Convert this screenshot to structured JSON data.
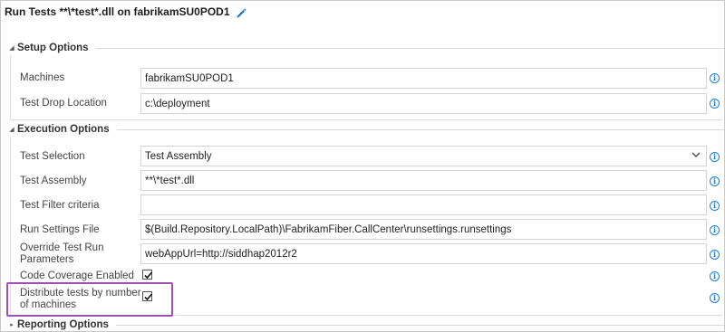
{
  "title": "Run Tests **\\*test*.dll on fabrikamSU0POD1",
  "icons": {
    "edit": "pencil-icon",
    "info": "info-icon",
    "expanded": "triangle-down-icon",
    "collapsed": "triangle-right-icon",
    "dropdown": "chevron-down-icon",
    "check": "checkmark-icon"
  },
  "colors": {
    "info": "#1a7fd4",
    "highlight": "#a04fb7",
    "edit": "#1a6fd0"
  },
  "setup": {
    "header": "Setup Options",
    "machines_label": "Machines",
    "machines_value": "fabrikamSU0POD1",
    "drop_label": "Test Drop Location",
    "drop_value": "c:\\deployment"
  },
  "execution": {
    "header": "Execution Options",
    "selection_label": "Test Selection",
    "selection_value": "Test Assembly",
    "assembly_label": "Test Assembly",
    "assembly_value": "**\\*test*.dll",
    "filter_label": "Test Filter criteria",
    "filter_value": "",
    "settings_label": "Run Settings File",
    "settings_value": "$(Build.Repository.LocalPath)\\FabrikamFiber.CallCenter\\runsettings.runsettings",
    "override_label": "Override Test Run Parameters",
    "override_value": "webAppUrl=http://siddhap2012r2",
    "coverage_label": "Code Coverage Enabled",
    "coverage_checked": true,
    "distribute_label": "Distribute tests by number of machines",
    "distribute_checked": true
  },
  "reporting": {
    "header": "Reporting Options"
  }
}
